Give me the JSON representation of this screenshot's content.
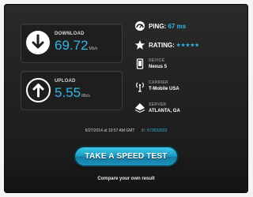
{
  "download": {
    "label": "DOWNLOAD",
    "value": "69.72",
    "unit": "Mb/s"
  },
  "upload": {
    "label": "UPLOAD",
    "value": "5.55",
    "unit": "Mb/s"
  },
  "ping": {
    "label": "PING:",
    "value": "67 ms"
  },
  "rating": {
    "label": "RATING:",
    "stars": "★★★★★",
    "count": 5
  },
  "device": {
    "label": "DEVICE",
    "value": "Nexus 5"
  },
  "carrier": {
    "label": "CARRIER",
    "value": "T-Mobile USA"
  },
  "server": {
    "label": "SERVER",
    "value": "ATLANTA, GA"
  },
  "footer": {
    "datetime": "6/27/2014 at 10:57 AM GMT",
    "id_label": "ID:",
    "id_value": "673532633"
  },
  "button": {
    "label": "TAKE A SPEED TEST"
  },
  "compare": {
    "text": "Compare your own result"
  },
  "colors": {
    "accent": "#33b5e5",
    "panel": "#1c1c1c",
    "button": "#1d9bc4"
  }
}
